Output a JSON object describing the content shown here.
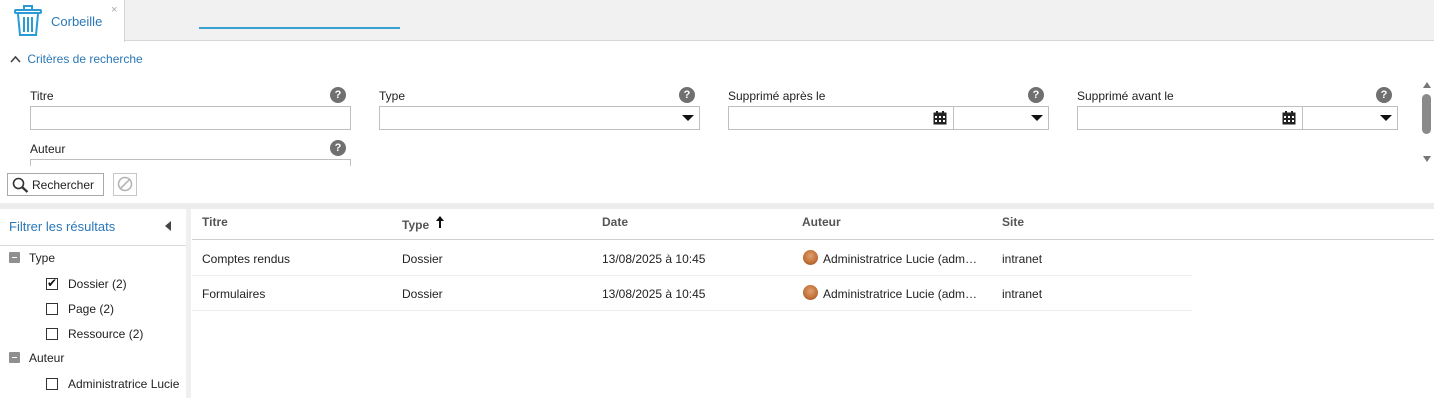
{
  "tab": {
    "label": "Corbeille",
    "close": "×",
    "icon": "trash-icon"
  },
  "criteria": {
    "title": "Critères de recherche",
    "fields": {
      "titre": {
        "label": "Titre",
        "value": ""
      },
      "type": {
        "label": "Type",
        "value": ""
      },
      "supprime_apres": {
        "label": "Supprimé après le",
        "value": ""
      },
      "supprime_avant": {
        "label": "Supprimé avant le",
        "value": ""
      },
      "auteur": {
        "label": "Auteur",
        "value": ""
      }
    },
    "help": "?"
  },
  "buttons": {
    "search": "Rechercher"
  },
  "filter": {
    "title": "Filtrer les résultats",
    "groups": [
      {
        "label": "Type",
        "options": [
          {
            "label": "Dossier (2)",
            "checked": true
          },
          {
            "label": "Page (2)",
            "checked": false
          },
          {
            "label": "Ressource (2)",
            "checked": false
          }
        ]
      },
      {
        "label": "Auteur",
        "options": [
          {
            "label": "Administratrice Lucie",
            "checked": false
          }
        ]
      }
    ]
  },
  "grid": {
    "columns": [
      "Titre",
      "Type",
      "Date",
      "Auteur",
      "Site"
    ],
    "sort_arrow": "🠕",
    "rows": [
      {
        "titre": "Comptes rendus",
        "type": "Dossier",
        "date": "13/08/2025 à 10:45",
        "auteur": "Administratrice Lucie (adm…",
        "site": "intranet"
      },
      {
        "titre": "Formulaires",
        "type": "Dossier",
        "date": "13/08/2025 à 10:45",
        "auteur": "Administratrice Lucie (adm…",
        "site": "intranet"
      }
    ]
  },
  "colors": {
    "accent": "#2a78b8",
    "sort_underline": "#3aa2d1"
  }
}
